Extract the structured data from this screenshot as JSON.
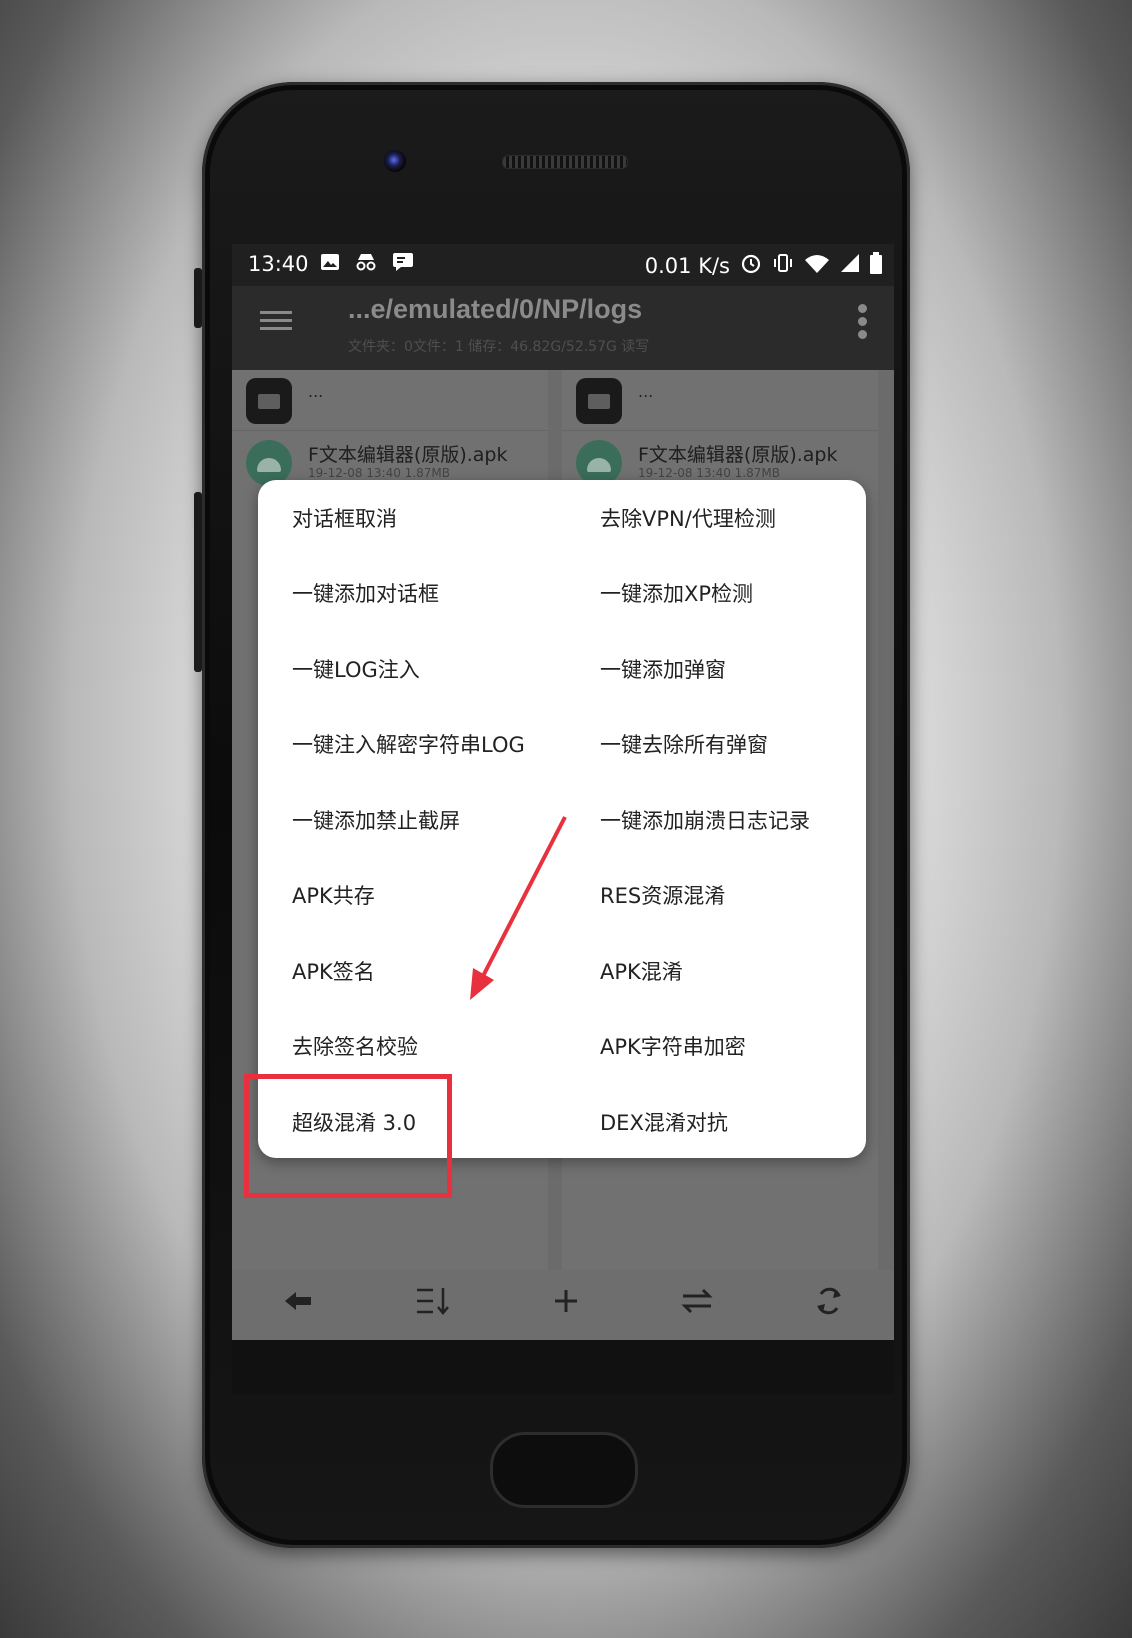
{
  "status_bar": {
    "time": "13:40",
    "net_speed": "0.01 K/s",
    "icons": [
      "image-icon",
      "incognito-icon",
      "message-icon",
      "alarm-icon",
      "vibrate-icon",
      "wifi-icon",
      "signal-icon",
      "battery-icon"
    ]
  },
  "app_bar": {
    "path": "...e/emulated/0/NP/logs",
    "subtitle": "文件夹：0文件：1 储存：46.82G/52.57G   读写"
  },
  "panes": [
    {
      "parent_label": "...",
      "file_name": "F文本编辑器(原版).apk",
      "file_meta": "19-12-08 13:40  1.87MB"
    },
    {
      "parent_label": "...",
      "file_name": "F文本编辑器(原版).apk",
      "file_meta": "19-12-08 13:40  1.87MB"
    }
  ],
  "dialog": {
    "items": [
      [
        "对话框取消",
        "去除VPN/代理检测"
      ],
      [
        "一键添加对话框",
        "一键添加XP检测"
      ],
      [
        "一键LOG注入",
        "一键添加弹窗"
      ],
      [
        "一键注入解密字符串LOG",
        "一键去除所有弹窗"
      ],
      [
        "一键添加禁止截屏",
        "一键添加崩溃日志记录"
      ],
      [
        "APK共存",
        "RES资源混淆"
      ],
      [
        "APK签名",
        "APK混淆"
      ],
      [
        "去除签名校验",
        "APK字符串加密"
      ],
      [
        "超级混淆 3.0",
        "DEX混淆对抗"
      ]
    ]
  },
  "bottom_bar": {
    "icons": [
      "back-arrow-icon",
      "sort-icon",
      "plus-icon",
      "swap-icon",
      "refresh-icon"
    ]
  },
  "annotation": {
    "highlight_color": "#e8303e",
    "highlighted_item": "超级混淆 3.0"
  }
}
